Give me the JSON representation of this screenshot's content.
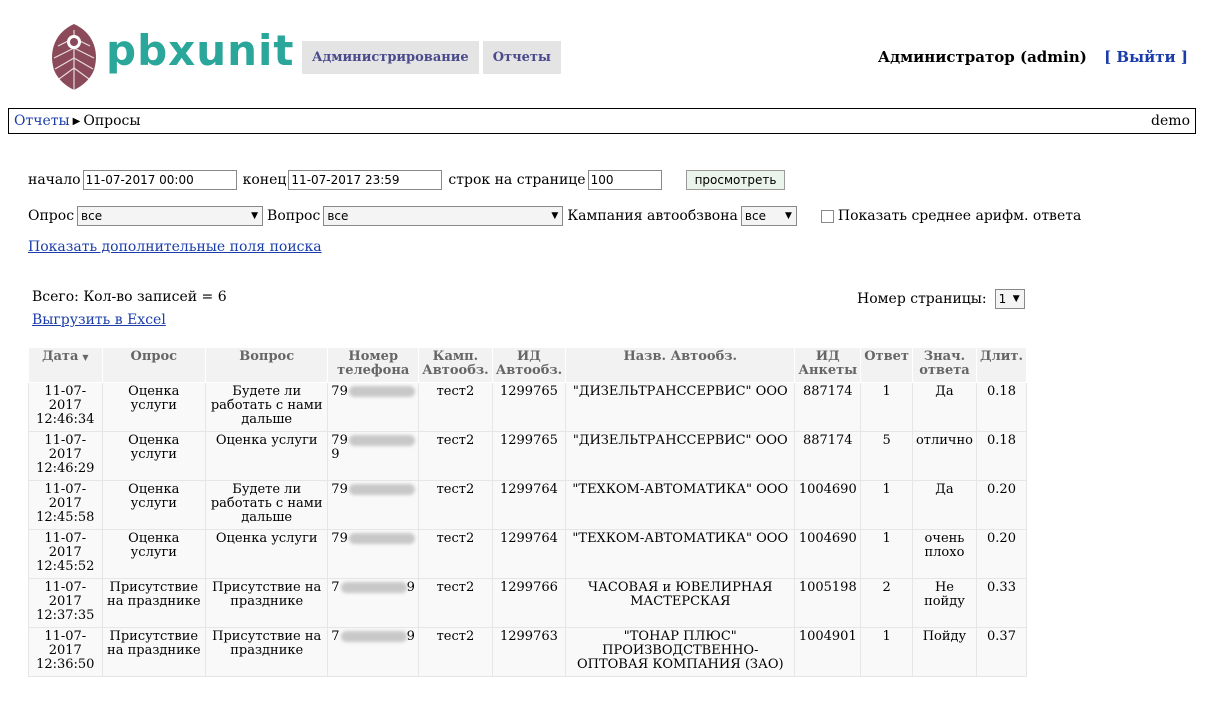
{
  "app": {
    "logo_text": "pbxunit"
  },
  "nav": [
    {
      "label": "Администрирование"
    },
    {
      "label": "Отчеты"
    }
  ],
  "user": {
    "name": "Администратор (admin)",
    "logout": "[ Выйти ]"
  },
  "breadcrumb": {
    "parent": "Отчеты",
    "current": "Опросы",
    "server": "demo"
  },
  "filters": {
    "start_label": "начало",
    "start_value": "11-07-2017 00:00",
    "end_label": "конец",
    "end_value": "11-07-2017 23:59",
    "rows_label": "строк на странице",
    "rows_value": "100",
    "view_button": "просмотреть",
    "survey_label": "Опрос",
    "survey_value": "все",
    "question_label": "Вопрос",
    "question_value": "все",
    "campaign_label": "Кампания автообзвона",
    "campaign_value": "все",
    "avg_label": "Показать среднее арифм. ответа",
    "more_fields": "Показать дополнительные поля поиска"
  },
  "summary": {
    "total": "Всего: Кол-во записей = 6",
    "export": "Выгрузить в Excel",
    "page_label": "Номер страницы:",
    "page_value": "1"
  },
  "table": {
    "headers": [
      "Дата",
      "Опрос",
      "Вопрос",
      "Номер телефона",
      "Камп. Автообз.",
      "ИД Автообз.",
      "Назв. Автообз.",
      "ИД Анкеты",
      "Ответ",
      "Знач. ответа",
      "Длит."
    ],
    "rows": [
      {
        "date": "11-07-2017 12:46:34",
        "survey": "Оценка услуги",
        "question": "Будете ли работать с нами дальше",
        "phone_prefix": "79",
        "phone_suffix": "",
        "campaign": "тест2",
        "campaign_id": "1299765",
        "campaign_name": "\"ДИЗЕЛЬТРАНССЕРВИС\" ООО",
        "form_id": "887174",
        "answer": "1",
        "answer_value": "Да",
        "duration": "0.18"
      },
      {
        "date": "11-07-2017 12:46:29",
        "survey": "Оценка услуги",
        "question": "Оценка услуги",
        "phone_prefix": "79",
        "phone_suffix": "9",
        "campaign": "тест2",
        "campaign_id": "1299765",
        "campaign_name": "\"ДИЗЕЛЬТРАНССЕРВИС\" ООО",
        "form_id": "887174",
        "answer": "5",
        "answer_value": "отлично",
        "duration": "0.18"
      },
      {
        "date": "11-07-2017 12:45:58",
        "survey": "Оценка услуги",
        "question": "Будете ли работать с нами дальше",
        "phone_prefix": "79",
        "phone_suffix": "",
        "campaign": "тест2",
        "campaign_id": "1299764",
        "campaign_name": "\"ТЕХКОМ-АВТОМАТИКА\" ООО",
        "form_id": "1004690",
        "answer": "1",
        "answer_value": "Да",
        "duration": "0.20"
      },
      {
        "date": "11-07-2017 12:45:52",
        "survey": "Оценка услуги",
        "question": "Оценка услуги",
        "phone_prefix": "79",
        "phone_suffix": "",
        "campaign": "тест2",
        "campaign_id": "1299764",
        "campaign_name": "\"ТЕХКОМ-АВТОМАТИКА\" ООО",
        "form_id": "1004690",
        "answer": "1",
        "answer_value": "очень плохо",
        "duration": "0.20"
      },
      {
        "date": "11-07-2017 12:37:35",
        "survey": "Присутствие на празднике",
        "question": "Присутствие на празднике",
        "phone_prefix": "7",
        "phone_suffix": "9",
        "campaign": "тест2",
        "campaign_id": "1299766",
        "campaign_name": "ЧАСОВАЯ и ЮВЕЛИРНАЯ МАСТЕРСКАЯ",
        "form_id": "1005198",
        "answer": "2",
        "answer_value": "Не пойду",
        "duration": "0.33"
      },
      {
        "date": "11-07-2017 12:36:50",
        "survey": "Присутствие на празднике",
        "question": "Присутствие на празднике",
        "phone_prefix": "7",
        "phone_suffix": "9",
        "campaign": "тест2",
        "campaign_id": "1299763",
        "campaign_name": "\"ТОНАР ПЛЮС\" ПРОИЗВОДСТВЕННО-ОПТОВАЯ КОМПАНИЯ (ЗАО)",
        "form_id": "1004901",
        "answer": "1",
        "answer_value": "Пойду",
        "duration": "0.37"
      }
    ]
  },
  "colors": {
    "accent": "#2aa69a",
    "logo_feather": "#8a4a5a",
    "link": "#1a3caa",
    "nav_text": "#4a4a8c"
  },
  "icons": {
    "logo": "feather-logo-icon",
    "sort": "sort-down-icon",
    "dropdown": "chevron-down-icon"
  }
}
